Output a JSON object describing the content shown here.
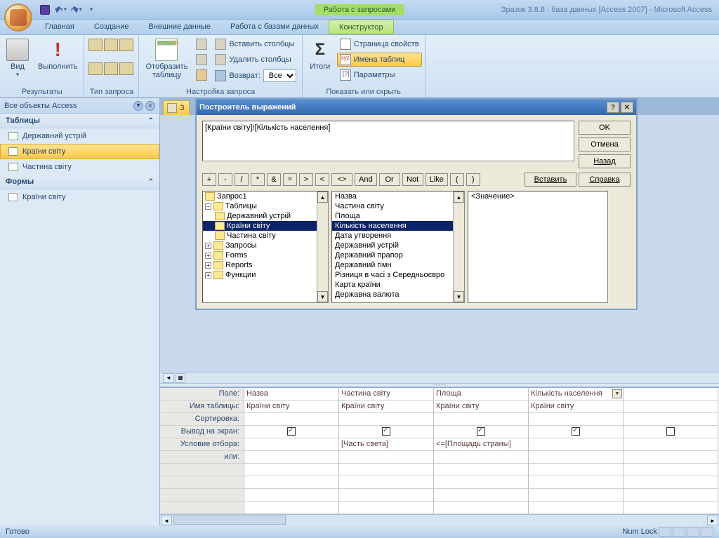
{
  "titlebar": {
    "context_tab": "Работа с запросами",
    "title": "Зразок 3.8.8 : база данных [Access 2007] - Microsoft Access"
  },
  "ribbon_tabs": [
    "Главная",
    "Создание",
    "Внешние данные",
    "Работа с базами данных",
    "Конструктор"
  ],
  "ribbon_active": 4,
  "ribbon": {
    "g1": {
      "label": "Результаты",
      "view": "Вид",
      "run": "Выполнить"
    },
    "g2": {
      "label": "Тип запроса"
    },
    "g3": {
      "label": "Настройка запроса",
      "show": "Отобразить\nтаблицу",
      "ins_col": "Вставить столбцы",
      "del_col": "Удалить столбцы",
      "return": "Возврат:",
      "return_val": "Все"
    },
    "g4": {
      "label": "Показать или скрыть",
      "totals": "Итоги",
      "props": "Страница свойств",
      "tblnames": "Имена таблиц",
      "params": "Параметры"
    }
  },
  "navpane": {
    "header": "Все объекты Access",
    "cat_tables": "Таблицы",
    "tables": [
      "Державний устрій",
      "Країни світу",
      "Частина світу"
    ],
    "table_selected": 1,
    "cat_forms": "Формы",
    "forms": [
      "Країни світу"
    ]
  },
  "doctab": "З",
  "dialog": {
    "title": "Построитель выражений",
    "expr": "[Країни світу]![Кількість населення]",
    "btns": {
      "ok": "OK",
      "cancel": "Отмена",
      "back": "Назад",
      "help": "Справка",
      "paste": "Вставить"
    },
    "ops": [
      "+",
      "-",
      "/",
      "*",
      "&",
      "=",
      ">",
      "<",
      "<>",
      "And",
      "Or",
      "Not",
      "Like",
      "(",
      ")"
    ],
    "tree": {
      "root": "Запрос1",
      "tables_label": "Таблицы",
      "tbls": [
        "Державний устрій",
        "Країни світу",
        "Частина світу"
      ],
      "tbl_selected": 1,
      "queries": "Запросы",
      "forms": "Forms",
      "reports": "Reports",
      "funcs": "Функции"
    },
    "fields": [
      "Назва",
      "Частина світу",
      "Площа",
      "Кількість населення",
      "Дата утворення",
      "Державний устрій",
      "Державний прапор",
      "Державний гімн",
      "Різниця в часі з Середньоєвро",
      "Карта країни",
      "Державна валюта"
    ],
    "field_selected": 3,
    "values": [
      "<Значение>"
    ]
  },
  "qgrid": {
    "labels": [
      "Поле:",
      "Имя таблицы:",
      "Сортировка:",
      "Вывод на экран:",
      "Условие отбора:",
      "или:"
    ],
    "cols": [
      {
        "field": "Назва",
        "table": "Країни світу",
        "show": true,
        "crit": ""
      },
      {
        "field": "Частина світу",
        "table": "Країни світу",
        "show": true,
        "crit": "[Часть света]"
      },
      {
        "field": "Площа",
        "table": "Країни світу",
        "show": true,
        "crit": "<=[Площадь страны]"
      },
      {
        "field": "Кількість населення",
        "table": "Країни світу",
        "show": true,
        "crit": "",
        "dd": true
      },
      {
        "field": "",
        "table": "",
        "show": false,
        "crit": ""
      }
    ]
  },
  "status": {
    "ready": "Готово",
    "numlock": "Num Lock"
  }
}
